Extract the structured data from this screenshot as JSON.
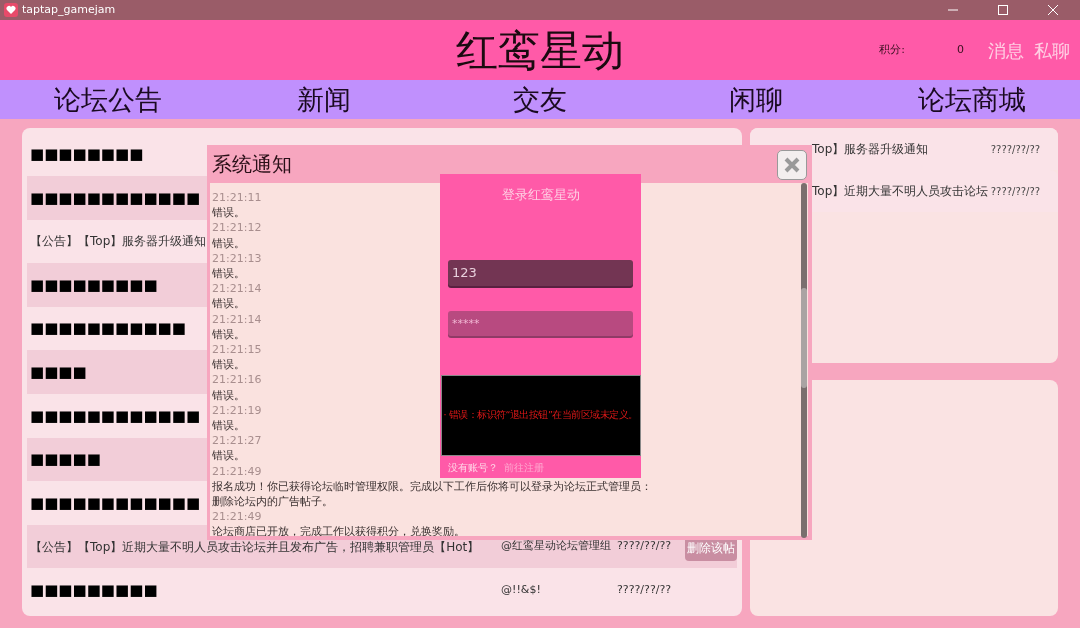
{
  "window": {
    "title": "taptap_gamejam"
  },
  "header": {
    "title": "红鸾星动",
    "points_label": "积分:",
    "points": "0",
    "links": [
      "消息",
      "私聊"
    ]
  },
  "nav": [
    "论坛公告",
    "新闻",
    "交友",
    "闲聊",
    "论坛商城"
  ],
  "posts": [
    {
      "title": "■■■■■■■■"
    },
    {
      "title": "■■■■■■■■■■■■"
    },
    {
      "title": "【公告】【Top】服务器升级通知"
    },
    {
      "title": "■■■■■■■■■"
    },
    {
      "title": "■■■■■■■■■■■"
    },
    {
      "title": "■■■■"
    },
    {
      "title": "■■■■■■■■■■■■"
    },
    {
      "title": "■■■■■"
    },
    {
      "title": "■■■■■■■■■■■■"
    },
    {
      "title": "【公告】【Top】近期大量不明人员攻击论坛并且发布广告，招聘兼职管理员【Hot】",
      "author": "@红鸾星动论坛管理组",
      "date": "????/??/??",
      "action": "删除该帖"
    },
    {
      "title": "■■■■■■■■■",
      "author": "@!!&$!",
      "date": "????/??/??"
    }
  ],
  "pinned": [
    {
      "title": "Top】服务器升级通知",
      "date": "????/??/??"
    },
    {
      "title": "Top】近期大量不明人员攻击论坛",
      "date": "????/??/??"
    }
  ],
  "notice": {
    "title": "系统通知",
    "log": [
      {
        "time": "21:21:11",
        "message": "错误。"
      },
      {
        "time": "21:21:12",
        "message": "错误。"
      },
      {
        "time": "21:21:13",
        "message": "错误。"
      },
      {
        "time": "21:21:14",
        "message": "错误。"
      },
      {
        "time": "21:21:14",
        "message": "错误。"
      },
      {
        "time": "21:21:15",
        "message": "错误。"
      },
      {
        "time": "21:21:16",
        "message": "错误。"
      },
      {
        "time": "21:21:19",
        "message": "错误。"
      },
      {
        "time": "21:21:27",
        "message": "错误。"
      },
      {
        "time": "21:21:49",
        "message": "报名成功！你已获得论坛临时管理权限。完成以下工作后你将可以登录为论坛正式管理员：",
        "extra": "删除论坛内的广告帖子。"
      },
      {
        "time": "21:21:49",
        "message": "论坛商店已开放，完成工作以获得积分，兑换奖励。"
      }
    ]
  },
  "login": {
    "title": "登录红鸾星动",
    "username": "123",
    "password_placeholder": "*****",
    "console": "· 错误：标识符“退出按钮”在当前区域未定义。",
    "no_account": "没有账号？",
    "register": "前往注册"
  }
}
